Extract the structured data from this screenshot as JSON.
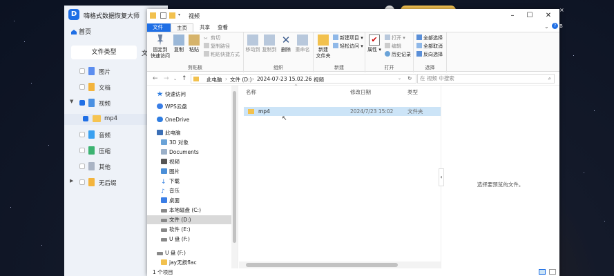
{
  "recovery_app": {
    "title": "嗨格式数据恢复大师",
    "logo_letter": "D",
    "home": "首页",
    "type_tab": "文件类型",
    "type_tab2": "文",
    "categories": [
      {
        "label": "图片",
        "color": "#5b8def"
      },
      {
        "label": "文档",
        "color": "#f3b43d"
      },
      {
        "label": "视频",
        "color": "#4a90e2",
        "expanded": true
      },
      {
        "label": "mp4",
        "color": "#f6c451",
        "selected": true
      },
      {
        "label": "音频",
        "color": "#3aa0f0"
      },
      {
        "label": "压缩",
        "color": "#3cb371"
      },
      {
        "label": "其他",
        "color": "#aab4c4"
      },
      {
        "label": "无后缀",
        "color": "#f3b43d"
      }
    ]
  },
  "explorer": {
    "title": "视频",
    "ribbon_tabs": [
      "文件",
      "主页",
      "共享",
      "查看"
    ],
    "ribbon": {
      "clipboard": {
        "label": "剪贴板",
        "pin": "固定到\n快速访问",
        "copy": "复制",
        "paste": "粘贴",
        "cut": "剪切",
        "copy_path": "复制路径",
        "paste_shortcut": "粘贴快捷方式"
      },
      "organize": {
        "label": "组织",
        "move_to": "移动到",
        "copy_to": "复制到",
        "delete": "删除",
        "rename": "重命名"
      },
      "new": {
        "label": "新建",
        "new_folder": "新建\n文件夹",
        "new_item": "新建项目",
        "easy_access": "轻松访问"
      },
      "open": {
        "label": "打开",
        "properties": "属性",
        "open": "打开",
        "edit": "编辑",
        "history": "历史记录"
      },
      "select": {
        "label": "选择",
        "select_all": "全部选择",
        "select_none": "全部取消",
        "invert": "反向选择"
      }
    },
    "address": [
      "此电脑",
      "文件 (D:)",
      "2024-07-23 15.02.26",
      "视频"
    ],
    "search_placeholder": "在 视频 中搜索",
    "nav": [
      {
        "label": "快速访问",
        "color": "#2f7de1",
        "indent": 0
      },
      {
        "label": "WPS云盘",
        "color": "#3a7ee6",
        "indent": 0
      },
      {
        "label": "OneDrive",
        "color": "#2f7de1",
        "indent": 0
      },
      {
        "label": "此电脑",
        "color": "#3b6fb6",
        "indent": 0
      },
      {
        "label": "3D 对象",
        "color": "#6aa3d8",
        "indent": 1
      },
      {
        "label": "Documents",
        "color": "#9bb0c8",
        "indent": 1
      },
      {
        "label": "视频",
        "color": "#555555",
        "indent": 1
      },
      {
        "label": "图片",
        "color": "#4a8fd8",
        "indent": 1
      },
      {
        "label": "下载",
        "color": "#2f7de1",
        "indent": 1
      },
      {
        "label": "音乐",
        "color": "#2f7de1",
        "indent": 1
      },
      {
        "label": "桌面",
        "color": "#3a7ee6",
        "indent": 1
      },
      {
        "label": "本地磁盘 (C:)",
        "color": "#888888",
        "indent": 1
      },
      {
        "label": "文件 (D:)",
        "color": "#888888",
        "indent": 1,
        "selected": true
      },
      {
        "label": "软件 (E:)",
        "color": "#888888",
        "indent": 1
      },
      {
        "label": "U 盘 (F:)",
        "color": "#888888",
        "indent": 1
      },
      {
        "label": "U 盘 (F:)",
        "color": "#888888",
        "indent": 0
      },
      {
        "label": "jay无损flac",
        "color": "#f2c14e",
        "indent": 1
      }
    ],
    "columns": {
      "name": "名称",
      "modified": "修改日期",
      "type": "类型"
    },
    "rows": [
      {
        "name": "mp4",
        "modified": "2024/7/23 15:02",
        "type": "文件夹"
      }
    ],
    "preview_text": "选择要预览的文件。",
    "status": "1 个项目"
  },
  "colors": {
    "accent": "#1f6fe5",
    "selection": "#cce4f7",
    "folder": "#f2c14e"
  }
}
